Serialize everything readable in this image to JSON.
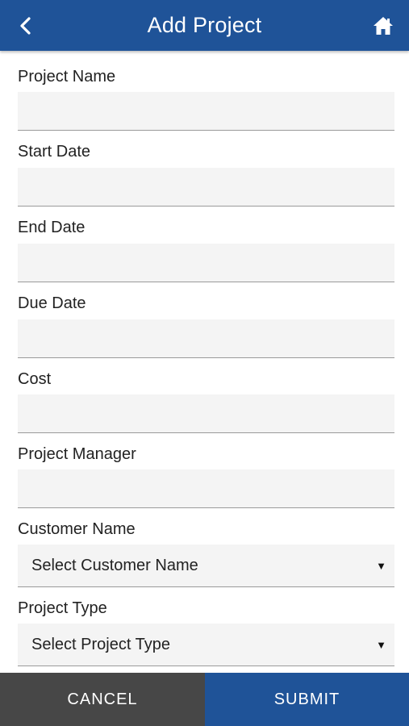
{
  "header": {
    "title": "Add Project",
    "back_icon": "chevron-left-icon",
    "home_icon": "home-icon"
  },
  "form": {
    "project_name": {
      "label": "Project Name",
      "value": ""
    },
    "start_date": {
      "label": "Start Date",
      "value": ""
    },
    "end_date": {
      "label": "End Date",
      "value": ""
    },
    "due_date": {
      "label": "Due Date",
      "value": ""
    },
    "cost": {
      "label": "Cost",
      "value": ""
    },
    "project_manager": {
      "label": "Project Manager",
      "value": ""
    },
    "customer_name": {
      "label": "Customer Name",
      "selected": "Select Customer Name",
      "arrow": "▼"
    },
    "project_type": {
      "label": "Project Type",
      "selected": "Select Project Type",
      "arrow": "▼"
    }
  },
  "footer": {
    "cancel_label": "CANCEL",
    "submit_label": "SUBMIT"
  },
  "colors": {
    "primary": "#1f5398",
    "cancel": "#474747",
    "field_bg": "#f4f4f4"
  }
}
